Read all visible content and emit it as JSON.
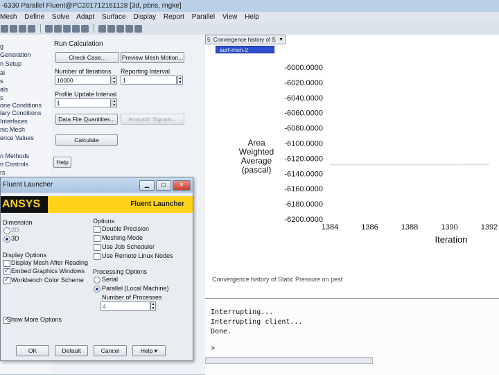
{
  "window": {
    "title": "-6330 Parallel Fluent@PC201712161128  [3d, pbns, rngke]"
  },
  "menu": [
    "Mesh",
    "Define",
    "Solve",
    "Adapt",
    "Surface",
    "Display",
    "Report",
    "Parallel",
    "View",
    "Help"
  ],
  "tree": {
    "items": [
      "g",
      "Generation",
      "n Setup",
      "al",
      "s",
      "als",
      "s",
      "one Conditions",
      "lary Conditions",
      "Interfaces",
      "nic Mesh",
      "ence Values",
      "n Methods",
      "n Controls",
      "rs"
    ]
  },
  "run_calc": {
    "heading": "Run Calculation",
    "check_case": "Check Case...",
    "preview_mesh": "Preview Mesh Motion...",
    "iterations_label": "Number of Iterations",
    "iterations_value": "10000",
    "reporting_label": "Reporting Interval",
    "reporting_value": "1",
    "profile_label": "Profile Update Interval",
    "profile_value": "1",
    "data_file": "Data File Quantities...",
    "acoustic": "Acoustic Signals...",
    "calculate": "Calculate",
    "help": "Help"
  },
  "chart_window": {
    "selector": "5: Convergence history of S",
    "caption": "Convergence history of Static Pressure on pest"
  },
  "chart_data": {
    "type": "line",
    "series": [
      {
        "name": "surf-mon-2",
        "x": [
          1384,
          1386,
          1388,
          1390,
          1392
        ],
        "y": [
          -6128.5,
          -6128.4,
          -6128.3,
          -6128.3,
          -6128.2
        ]
      }
    ],
    "xlabel": "Iteration",
    "ylabel": [
      "Area",
      "Weighted",
      "Average",
      "(pascal)"
    ],
    "xticks": [
      "1384",
      "1386",
      "1388",
      "1390",
      "1392"
    ],
    "yticks": [
      "-6000.0000",
      "-6020.0000",
      "-6040.0000",
      "-6060.0000",
      "-6080.0000",
      "-6100.0000",
      "-6120.0000",
      "-6140.0000",
      "-6160.0000",
      "-6180.0000",
      "-6200.0000"
    ],
    "xlim": [
      1384,
      1392
    ],
    "ylim": [
      -6200,
      -6000
    ],
    "legend": "top-left",
    "grid": false,
    "line_color": "#d9dde3"
  },
  "console": {
    "lines": "Interrupting...\nInterrupting client...\nDone.",
    "prompt": ">"
  },
  "launcher": {
    "title": "Fluent Launcher",
    "logo": "ANSYS",
    "brand": "Fluent  Launcher",
    "dimension_label": "Dimension",
    "dim_2d": "2D",
    "dim_3d": "3D",
    "display_options_label": "Display Options",
    "display_mesh": "Display Mesh After Reading",
    "embed_graphics": "Embed Graphics Windows",
    "workbench_color": "Workbench Color Scheme",
    "options_label": "Options",
    "double_precision": "Double Precision",
    "meshing_mode": "Meshing Mode",
    "use_job_scheduler": "Use Job Scheduler",
    "use_remote_linux": "Use Remote Linux Nodes",
    "processing_label": "Processing Options",
    "serial": "Serial",
    "parallel": "Parallel (Local Machine)",
    "num_processes_label": "Number of Processes",
    "num_processes_value": "4",
    "show_more": "Show More Options",
    "ok": "OK",
    "default": "Default",
    "cancel": "Cancel",
    "help": "Help"
  },
  "colors": {
    "legend_bg": "#2a4fcf",
    "chart_bg": "#ffffff",
    "ansys_yellow": "#ffd21a"
  }
}
